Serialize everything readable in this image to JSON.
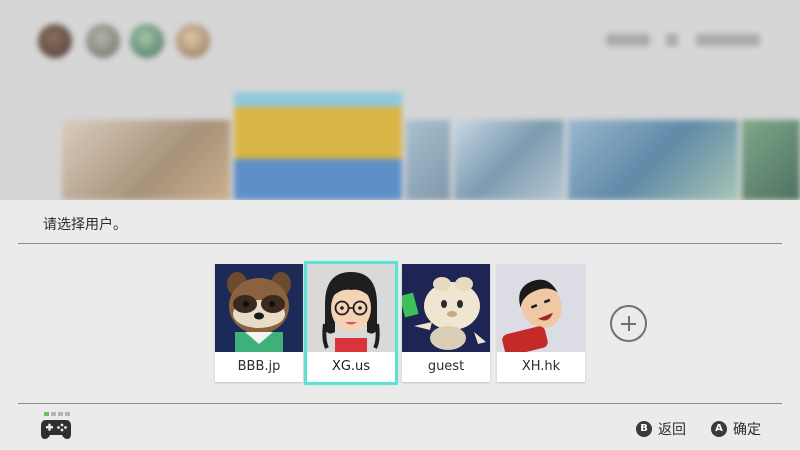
{
  "background": {
    "avatars": [
      {
        "color": "#6b5b4e"
      },
      {
        "color": "#8a8a80"
      },
      {
        "color": "#5f8a7c"
      },
      {
        "color": "#b69b7e"
      }
    ],
    "tiles": [
      {
        "color": "#c6b9a9"
      },
      {
        "color": "#d2b25a"
      },
      {
        "color": "#7fa9c9"
      },
      {
        "color": "#9fb8c9"
      },
      {
        "color": "#8fa6b8"
      },
      {
        "color": "#8fbf9a"
      },
      {
        "color": "#6f8f7a"
      }
    ]
  },
  "panel": {
    "prompt": "请选择用户。"
  },
  "users": [
    {
      "name": "BBB.jp",
      "avatar": "tanuki-avatar",
      "bg": "#1c2a57",
      "selected": false
    },
    {
      "name": "XG.us",
      "avatar": "mii-girl-glasses-avatar",
      "bg": "#d9d9d9",
      "selected": true
    },
    {
      "name": "guest",
      "avatar": "chibi-creature-avatar",
      "bg": "#1e2555",
      "selected": false
    },
    {
      "name": "XH.hk",
      "avatar": "mii-boy-avatar",
      "bg": "#dcdce4",
      "selected": false
    }
  ],
  "add_user": {
    "icon": "plus-circle-icon"
  },
  "footer": {
    "back": {
      "button": "B",
      "label": "返回"
    },
    "ok": {
      "button": "A",
      "label": "确定"
    }
  },
  "colors": {
    "selection": "#5ee0d2",
    "controller_indicator": "#63c25a"
  }
}
